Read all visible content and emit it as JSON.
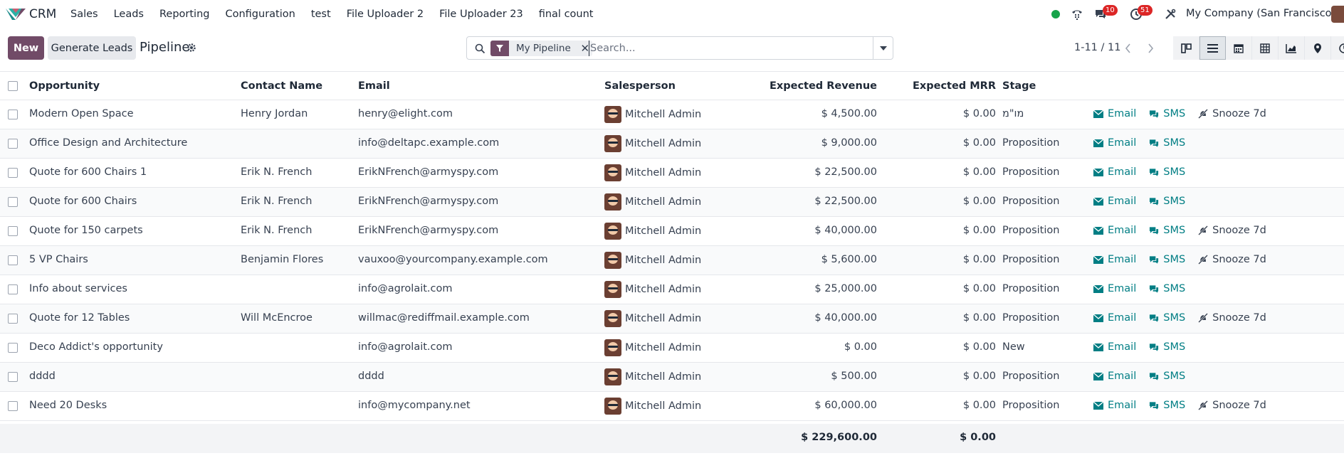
{
  "navbar": {
    "app_name": "CRM",
    "menu": [
      "Sales",
      "Leads",
      "Reporting",
      "Configuration",
      "test",
      "File Uploader 2",
      "File Uploader 23",
      "final count"
    ],
    "chat_badge": "10",
    "activity_badge": "51",
    "company": "My Company (San Francisco)",
    "icons": [
      "status-online-icon",
      "phone-icon",
      "chat-icon",
      "clock-activity-icon",
      "tools-icon"
    ]
  },
  "control": {
    "new_label": "New",
    "generate_label": "Generate Leads",
    "breadcrumb": "Pipeline",
    "facet_label": "My Pipeline",
    "search_placeholder": "Search...",
    "pager": "1-11 / 11",
    "views": [
      "kanban",
      "list",
      "calendar",
      "pivot",
      "graph",
      "map",
      "activity"
    ],
    "active_view": "list"
  },
  "colors": {
    "brand": "#714b67",
    "link": "#017e84",
    "badge": "#dc2626",
    "online": "#16a34a"
  },
  "table": {
    "headers": {
      "opportunity": "Opportunity",
      "contact": "Contact Name",
      "email": "Email",
      "salesperson": "Salesperson",
      "revenue": "Expected Revenue",
      "mrr": "Expected MRR",
      "stage": "Stage"
    },
    "actions": {
      "email": "Email",
      "sms": "SMS",
      "snooze": "Snooze 7d"
    },
    "rows": [
      {
        "opportunity": "Modern Open Space",
        "contact": "Henry Jordan",
        "email": "henry@elight.com",
        "salesperson": "Mitchell Admin",
        "revenue": "$ 4,500.00",
        "mrr": "$ 0.00",
        "stage": "מו\"מ",
        "snooze": "Snooze 7d"
      },
      {
        "opportunity": "Office Design and Architecture",
        "contact": "",
        "email": "info@deltapc.example.com",
        "salesperson": "Mitchell Admin",
        "revenue": "$ 9,000.00",
        "mrr": "$ 0.00",
        "stage": "Proposition",
        "snooze": ""
      },
      {
        "opportunity": "Quote for 600 Chairs 1",
        "contact": "Erik N. French",
        "email": "ErikNFrench@armyspy.com",
        "salesperson": "Mitchell Admin",
        "revenue": "$ 22,500.00",
        "mrr": "$ 0.00",
        "stage": "Proposition",
        "snooze": ""
      },
      {
        "opportunity": "Quote for 600 Chairs",
        "contact": "Erik N. French",
        "email": "ErikNFrench@armyspy.com",
        "salesperson": "Mitchell Admin",
        "revenue": "$ 22,500.00",
        "mrr": "$ 0.00",
        "stage": "Proposition",
        "snooze": ""
      },
      {
        "opportunity": "Quote for 150 carpets",
        "contact": "Erik N. French",
        "email": "ErikNFrench@armyspy.com",
        "salesperson": "Mitchell Admin",
        "revenue": "$ 40,000.00",
        "mrr": "$ 0.00",
        "stage": "Proposition",
        "snooze": "Snooze 7d"
      },
      {
        "opportunity": "5 VP Chairs",
        "contact": "Benjamin Flores",
        "email": "vauxoo@yourcompany.example.com",
        "salesperson": "Mitchell Admin",
        "revenue": "$ 5,600.00",
        "mrr": "$ 0.00",
        "stage": "Proposition",
        "snooze": "Snooze 7d"
      },
      {
        "opportunity": "Info about services",
        "contact": "",
        "email": "info@agrolait.com",
        "salesperson": "Mitchell Admin",
        "revenue": "$ 25,000.00",
        "mrr": "$ 0.00",
        "stage": "Proposition",
        "snooze": ""
      },
      {
        "opportunity": "Quote for 12 Tables",
        "contact": "Will McEncroe",
        "email": "willmac@rediffmail.example.com",
        "salesperson": "Mitchell Admin",
        "revenue": "$ 40,000.00",
        "mrr": "$ 0.00",
        "stage": "Proposition",
        "snooze": "Snooze 7d"
      },
      {
        "opportunity": "Deco Addict's opportunity",
        "contact": "",
        "email": "info@agrolait.com",
        "salesperson": "Mitchell Admin",
        "revenue": "$ 0.00",
        "mrr": "$ 0.00",
        "stage": "New",
        "snooze": ""
      },
      {
        "opportunity": "dddd",
        "contact": "",
        "email": "dddd",
        "salesperson": "Mitchell Admin",
        "revenue": "$ 500.00",
        "mrr": "$ 0.00",
        "stage": "Proposition",
        "snooze": ""
      },
      {
        "opportunity": "Need 20 Desks",
        "contact": "",
        "email": "info@mycompany.net",
        "salesperson": "Mitchell Admin",
        "revenue": "$ 60,000.00",
        "mrr": "$ 0.00",
        "stage": "Proposition",
        "snooze": "Snooze 7d"
      }
    ],
    "totals": {
      "revenue": "$ 229,600.00",
      "mrr": "$ 0.00"
    }
  }
}
